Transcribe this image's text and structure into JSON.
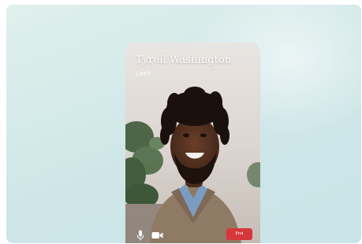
{
  "call": {
    "caller_name": "Tyrell Washington",
    "caller_role": "LMFT",
    "end_label": "End"
  },
  "controls": {
    "mic_icon": "microphone-icon",
    "camera_icon": "video-camera-icon"
  },
  "colors": {
    "background": "#d7ece9",
    "end_button": "#d6373a",
    "text": "#ffffff"
  }
}
